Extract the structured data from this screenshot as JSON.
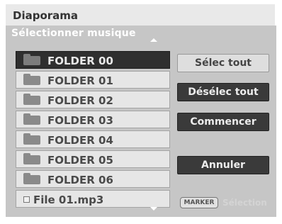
{
  "dialog": {
    "title": "Diaporama",
    "section_label": "Sélectionner musique"
  },
  "list": {
    "items": [
      {
        "label": "FOLDER 00",
        "type": "folder",
        "selected": true
      },
      {
        "label": "FOLDER 01",
        "type": "folder",
        "selected": false
      },
      {
        "label": "FOLDER 02",
        "type": "folder",
        "selected": false
      },
      {
        "label": "FOLDER 03",
        "type": "folder",
        "selected": false
      },
      {
        "label": "FOLDER 04",
        "type": "folder",
        "selected": false
      },
      {
        "label": "FOLDER 05",
        "type": "folder",
        "selected": false
      },
      {
        "label": "FOLDER 06",
        "type": "folder",
        "selected": false
      },
      {
        "label": "File 01.mp3",
        "type": "file",
        "selected": false
      }
    ]
  },
  "buttons": {
    "select_all": "Sélec tout",
    "deselect_all": "Désélec tout",
    "start": "Commencer",
    "cancel": "Annuler"
  },
  "footer": {
    "marker_label": "MARKER",
    "faded_label": "Sélection"
  }
}
